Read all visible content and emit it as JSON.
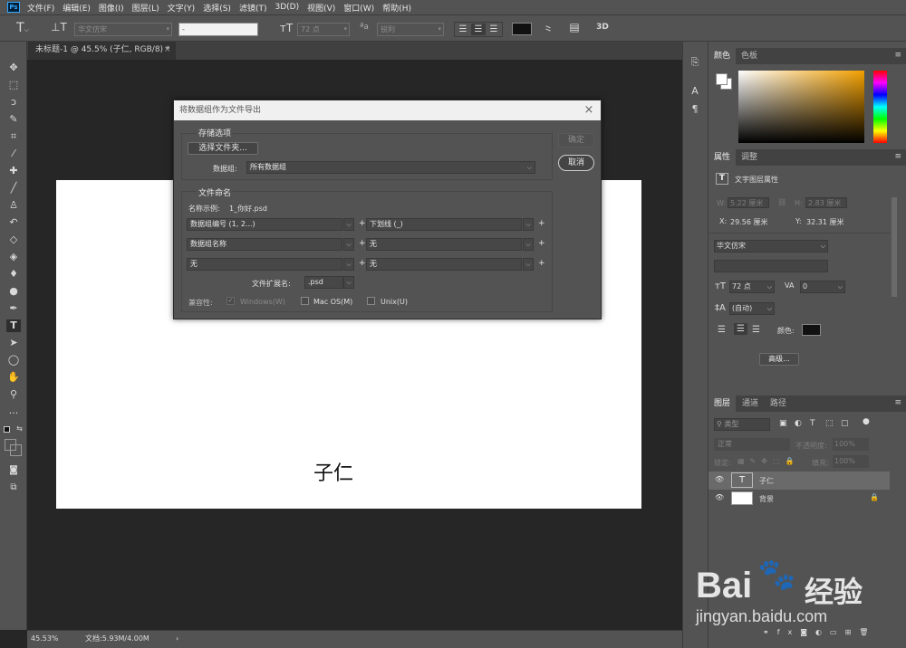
{
  "menu": {
    "items": [
      "文件(F)",
      "编辑(E)",
      "图像(I)",
      "图层(L)",
      "文字(Y)",
      "选择(S)",
      "滤镜(T)",
      "3D(D)",
      "视图(V)",
      "窗口(W)",
      "帮助(H)"
    ]
  },
  "options": {
    "font_family": "华文仿宋",
    "font_style": "-",
    "font_size": "72 点",
    "aa_label": "a",
    "aa_value": "锐利",
    "mode_3d": "3D"
  },
  "document": {
    "tab_title": "未标题-1 @ 45.5% (子仁, RGB/8) *",
    "text_layer": "子仁"
  },
  "status": {
    "zoom": "45.53%",
    "doc_info": "文档:5.93M/4.00M",
    "arrow": "›"
  },
  "dialog": {
    "title": "将数据组作为文件导出",
    "storage_group": "存储选项",
    "select_folder": "选择文件夹...",
    "dataset_label": "数据组:",
    "dataset_value": "所有数据组",
    "ok": "确定",
    "cancel": "取消",
    "naming_group": "文件命名",
    "example_label": "名称示例:",
    "example_value": "1_你好.psd",
    "row1": {
      "a": "数据组编号 (1, 2...)",
      "b": "下划线 (_)"
    },
    "row2": {
      "a": "数据组名称",
      "b": "无"
    },
    "row3": {
      "a": "无",
      "b": "无"
    },
    "plus": "+",
    "ext_label": "文件扩展名:",
    "ext_value": ".psd",
    "compat_label": "兼容性:",
    "windows": "Windows(W)",
    "mac": "Mac OS(M)",
    "unix": "Unix(U)"
  },
  "color_panel": {
    "tab1": "颜色",
    "tab2": "色板"
  },
  "props_panel": {
    "tab1": "属性",
    "tab2": "调整",
    "header": "文字图层属性",
    "w_label": "W:",
    "w_value": "5.22 厘米",
    "h_label": "H:",
    "h_value": "2.83 厘米",
    "x_label": "X:",
    "x_value": "29.56 厘米",
    "y_label": "Y:",
    "y_value": "32.31 厘米",
    "font": "华文仿宋",
    "size": "72 点",
    "tracking": "0",
    "leading": "(自动)",
    "color_label": "颜色:",
    "advanced": "高级..."
  },
  "layers_panel": {
    "tab1": "图层",
    "tab2": "通道",
    "tab3": "路径",
    "kind": "类型",
    "blend": "正常",
    "opacity_label": "不透明度:",
    "opacity": "100%",
    "lock_label": "锁定:",
    "fill_label": "填充:",
    "fill": "100%",
    "layers": [
      {
        "name": "子仁",
        "thumb": "T"
      },
      {
        "name": "背景",
        "thumb": ""
      }
    ]
  },
  "watermark": {
    "brand": "Bai",
    "brand2": "经验",
    "url": "jingyan.baidu.com"
  },
  "colors": {
    "foreground": "#ffffff",
    "background": "#ffffff",
    "text_color": "#111111",
    "accent": "#31a8ff"
  }
}
